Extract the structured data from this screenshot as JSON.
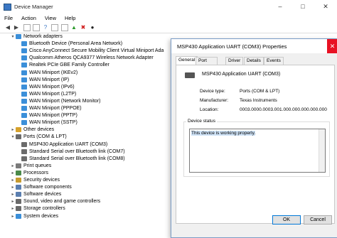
{
  "window": {
    "title": "Device Manager"
  },
  "menu": [
    "File",
    "Action",
    "View",
    "Help"
  ],
  "tree": [
    {
      "label": "Network adapters",
      "level": 1,
      "expand": "v",
      "icon": "network-adapter",
      "color": "#3b8fd9"
    },
    {
      "label": "Bluetooth Device (Personal Area Network)",
      "level": 2,
      "icon": "network-adapter",
      "color": "#3b8fd9"
    },
    {
      "label": "Cisco AnyConnect Secure Mobility Client Virtual Miniport Ada",
      "level": 2,
      "icon": "network-adapter",
      "color": "#3b8fd9"
    },
    {
      "label": "Qualcomm Atheros QCA9377 Wireless Network Adapter",
      "level": 2,
      "icon": "network-adapter",
      "color": "#3b8fd9"
    },
    {
      "label": "Realtek PCIe GBE Family Controller",
      "level": 2,
      "icon": "network-adapter",
      "color": "#3b8fd9"
    },
    {
      "label": "WAN Miniport (IKEv2)",
      "level": 2,
      "icon": "network-adapter",
      "color": "#3b8fd9"
    },
    {
      "label": "WAN Miniport (IP)",
      "level": 2,
      "icon": "network-adapter",
      "color": "#3b8fd9"
    },
    {
      "label": "WAN Miniport (IPv6)",
      "level": 2,
      "icon": "network-adapter",
      "color": "#3b8fd9"
    },
    {
      "label": "WAN Miniport (L2TP)",
      "level": 2,
      "icon": "network-adapter",
      "color": "#3b8fd9"
    },
    {
      "label": "WAN Miniport (Network Monitor)",
      "level": 2,
      "icon": "network-adapter",
      "color": "#3b8fd9"
    },
    {
      "label": "WAN Miniport (PPPOE)",
      "level": 2,
      "icon": "network-adapter",
      "color": "#3b8fd9"
    },
    {
      "label": "WAN Miniport (PPTP)",
      "level": 2,
      "icon": "network-adapter",
      "color": "#3b8fd9"
    },
    {
      "label": "WAN Miniport (SSTP)",
      "level": 2,
      "icon": "network-adapter",
      "color": "#3b8fd9"
    },
    {
      "label": "Other devices",
      "level": 1,
      "expand": ">",
      "icon": "other-devices",
      "color": "#d6a12b"
    },
    {
      "label": "Ports (COM & LPT)",
      "level": 1,
      "expand": "v",
      "icon": "port",
      "color": "#6b6b6b"
    },
    {
      "label": "MSP430 Application UART (COM3)",
      "level": 2,
      "icon": "port",
      "color": "#6b6b6b"
    },
    {
      "label": "Standard Serial over Bluetooth link (COM7)",
      "level": 2,
      "icon": "port",
      "color": "#6b6b6b"
    },
    {
      "label": "Standard Serial over Bluetooth link (COM8)",
      "level": 2,
      "icon": "port",
      "color": "#6b6b6b"
    },
    {
      "label": "Print queues",
      "level": 1,
      "expand": ">",
      "icon": "printer",
      "color": "#7a7a7a"
    },
    {
      "label": "Processors",
      "level": 1,
      "expand": ">",
      "icon": "processor",
      "color": "#4a8a4a"
    },
    {
      "label": "Security devices",
      "level": 1,
      "expand": ">",
      "icon": "security",
      "color": "#c79b2e"
    },
    {
      "label": "Software components",
      "level": 1,
      "expand": ">",
      "icon": "software",
      "color": "#5b7fb0"
    },
    {
      "label": "Software devices",
      "level": 1,
      "expand": ">",
      "icon": "software",
      "color": "#5b7fb0"
    },
    {
      "label": "Sound, video and game controllers",
      "level": 1,
      "expand": ">",
      "icon": "sound",
      "color": "#6a6a6a"
    },
    {
      "label": "Storage controllers",
      "level": 1,
      "expand": ">",
      "icon": "storage",
      "color": "#6a6a6a"
    },
    {
      "label": "System devices",
      "level": 1,
      "expand": ">",
      "icon": "system",
      "color": "#3b8fd9"
    }
  ],
  "dialog": {
    "title": "MSP430 Application UART (COM3) Properties",
    "tabs": [
      "General",
      "Port Settings",
      "Driver",
      "Details",
      "Events"
    ],
    "active_tab": "General",
    "device_name": "MSP430 Application UART (COM3)",
    "props": [
      {
        "label": "Device type:",
        "value": "Ports (COM & LPT)"
      },
      {
        "label": "Manufacturer:",
        "value": "Texas Instruments"
      },
      {
        "label": "Location:",
        "value": "0003.0000.0003.001.000.000.000.000.000"
      }
    ],
    "status_group_label": "Device status",
    "status_text": "This device is working properly.",
    "ok_label": "OK",
    "cancel_label": "Cancel"
  },
  "colors": {
    "close_red": "#e81123",
    "accent": "#0078d7"
  }
}
